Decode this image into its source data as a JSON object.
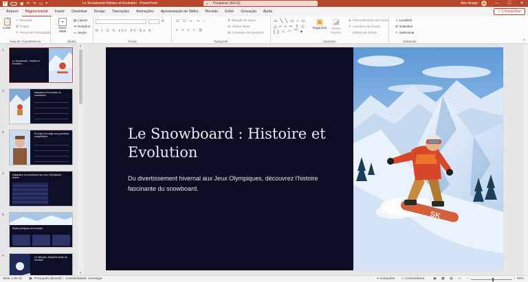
{
  "window": {
    "title": "Le Snowboard-Histoire-et-Evolution  -  PowerPoint",
    "search_placeholder": "Pesquisar (Alt+Q)",
    "user": "Alex Araujo",
    "avatar_initials": "AA",
    "minimize": "—",
    "maximize": "☐",
    "close": "✕"
  },
  "tabs": [
    "Arquivo",
    "Página Inicial",
    "Inserir",
    "Desenhar",
    "Design",
    "Transições",
    "Animações",
    "Apresentação de Slides",
    "Revisão",
    "Exibir",
    "Gravação",
    "Ajuda"
  ],
  "active_tab": "Página Inicial",
  "share_label": "Compartilhar",
  "ribbon": {
    "clipboard": {
      "label": "Área de Transferência",
      "paste": "Colar",
      "cut": "Recortar",
      "copy": "Copiar",
      "format_painter": "Pincel de Formatação"
    },
    "slides": {
      "label": "Slides",
      "new_slide": "Novo Slide",
      "layout": "Layout",
      "reset": "Redefinir",
      "section": "Seção"
    },
    "font": {
      "label": "Fonte",
      "format_buttons": "N I S S abc AV Aa A"
    },
    "paragraph": {
      "label": "Parágrafo",
      "direction": "Direção do Texto",
      "align": "Alinhar Texto",
      "smartart": "Converter em SmartArt"
    },
    "drawing": {
      "label": "Desenho",
      "arrange": "Organizar",
      "quick_styles": "Estilos Rápidos",
      "fill": "Preenchimento da Forma",
      "outline": "Contorno da Forma",
      "effects": "Efeitos de Forma"
    },
    "editing": {
      "label": "Editando",
      "find": "Localizar",
      "replace": "Substituir",
      "select": "Selecionar"
    }
  },
  "thumbnails": [
    {
      "num": "1",
      "title": "Le Snowboard : Histoire et Evolution"
    },
    {
      "num": "2",
      "title": "Naissance et évolution du snowboard"
    },
    {
      "num": "3",
      "title": "Du loisir à la neige aux premières compétitions"
    },
    {
      "num": "4",
      "title": "Intégration du snowboard aux Jeux Olympiques d'hiver"
    },
    {
      "num": "5",
      "title": "Styles principaux du freestyle"
    },
    {
      "num": "6",
      "title": "Le half-pipe, discipline phare du freestyle"
    }
  ],
  "slide": {
    "title": "Le Snowboard : Histoire et Evolution",
    "subtitle": "Du divertissement hivernal aux Jeux Olympiques, découvrez l'histoire fascinante du snowboard.",
    "board_text": "SK"
  },
  "status": {
    "slide_count": "Slide 1 de 22",
    "language": "Português (Brasil)",
    "accessibility": "Acessibilidade: investigar",
    "notes": "Anotações",
    "comments": "Comentários",
    "zoom": "94%"
  },
  "colors": {
    "accent": "#b7472a",
    "slide_bg": "#0b0d22"
  }
}
